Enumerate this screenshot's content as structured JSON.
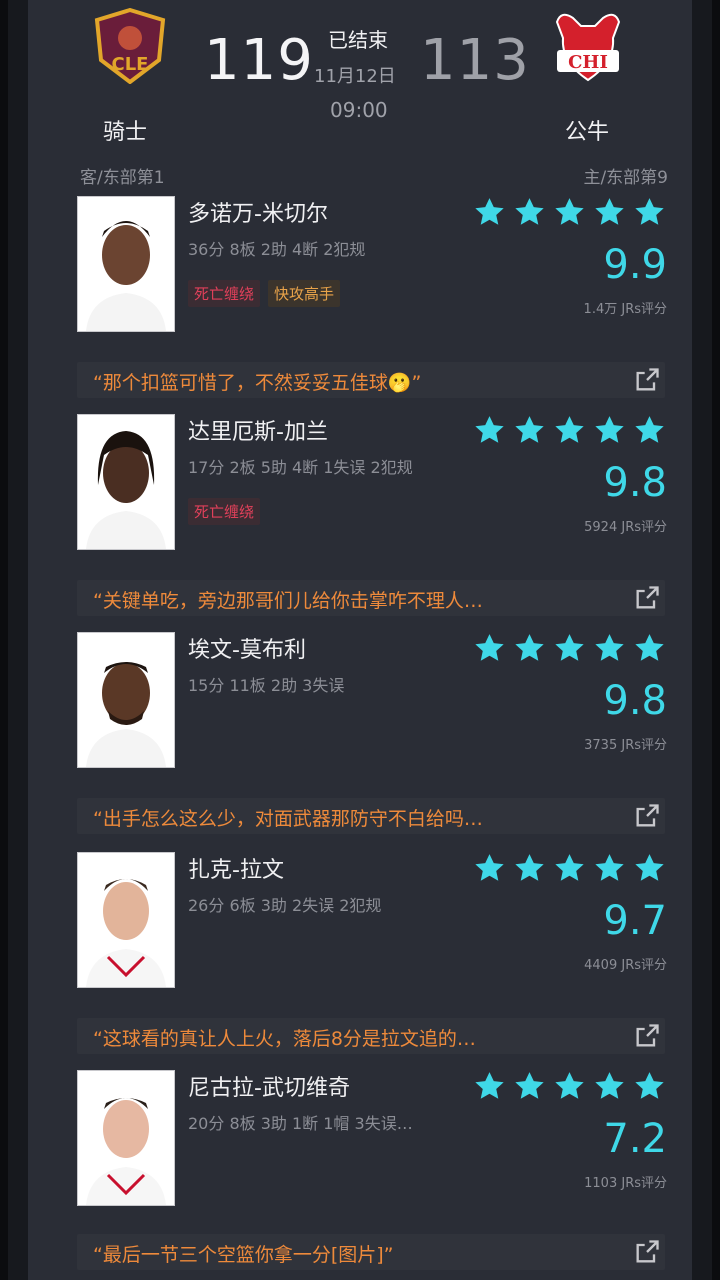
{
  "game": {
    "status": "已结束",
    "date": "11月12日",
    "time": "09:00",
    "away": {
      "abbr": "CLE",
      "name": "骑士",
      "score": "119",
      "rank": "客/东部第1"
    },
    "home": {
      "abbr": "CHI",
      "name": "公牛",
      "score": "113",
      "rank": "主/东部第9"
    }
  },
  "colors": {
    "accent": "#3fd8e8",
    "comment": "#ee8a3b",
    "tag_red": "#e0405a",
    "tag_orange": "#e8a34a"
  },
  "players": [
    {
      "name": "多诺万-米切尔",
      "stats": "36分 8板 2助 4断 2犯规",
      "tags": [
        "死亡缠绕",
        "快攻高手"
      ],
      "rating": "9.9",
      "count": "1.4万 JRs评分",
      "comment": "“那个扣篮可惜了，不然妥妥五佳球🫢”"
    },
    {
      "name": "达里厄斯-加兰",
      "stats": "17分 2板 5助 4断 1失误 2犯规",
      "tags": [
        "死亡缠绕"
      ],
      "rating": "9.8",
      "count": "5924 JRs评分",
      "comment": "“关键单吃，旁边那哥们儿给你击掌咋不理人…"
    },
    {
      "name": "埃文-莫布利",
      "stats": "15分 11板 2助 3失误",
      "tags": [],
      "rating": "9.8",
      "count": "3735 JRs评分",
      "comment": "“出手怎么这么少，对面武器那防守不白给吗…"
    },
    {
      "name": "扎克-拉文",
      "stats": "26分 6板 3助 2失误 2犯规",
      "tags": [],
      "rating": "9.7",
      "count": "4409 JRs评分",
      "comment": "“这球看的真让人上火，落后8分是拉文追的…"
    },
    {
      "name": "尼古拉-武切维奇",
      "stats": "20分 8板 3助 1断 1帽 3失误…",
      "tags": [],
      "rating": "7.2",
      "count": "1103 JRs评分",
      "comment": "“最后一节三个空篮你拿一分[图片]”"
    }
  ]
}
